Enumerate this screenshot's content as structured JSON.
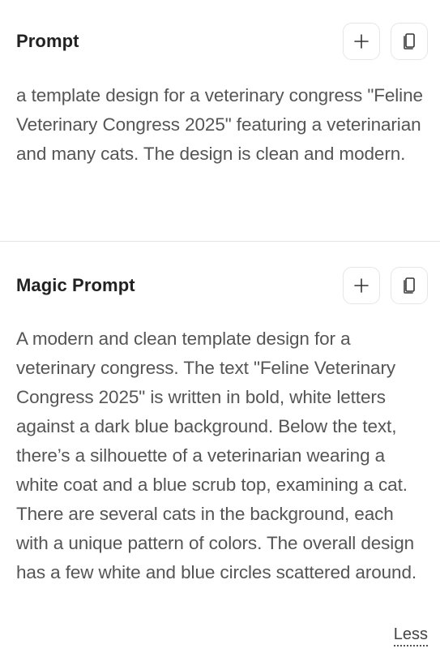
{
  "prompt_section": {
    "title": "Prompt",
    "text": "a template design for a veterinary congress \"Feline Veterinary Congress 2025\" featuring a veterinarian and many cats. The design is clean and modern.",
    "actions": [
      {
        "icon": "plus-icon",
        "label": "Add"
      },
      {
        "icon": "copy-icon",
        "label": "Copy"
      }
    ]
  },
  "magic_prompt_section": {
    "title": "Magic Prompt",
    "text": "A modern and clean template design for a veterinary congress. The text \"Feline Veterinary Congress 2025\" is written in bold, white letters against a dark blue background. Below the text, there’s a silhouette of a veterinarian wearing a white coat and a blue scrub top, examining a cat. There are several cats in the background, each with a unique pattern of colors. The overall design has a few white and blue circles scattered around.",
    "actions": [
      {
        "icon": "plus-icon",
        "label": "Add"
      },
      {
        "icon": "copy-icon",
        "label": "Copy"
      }
    ],
    "toggle_label": "Less"
  },
  "colors": {
    "title": "#222222",
    "body_text": "#555555",
    "border": "#e6e6e6",
    "divider": "#e4e4e4"
  }
}
